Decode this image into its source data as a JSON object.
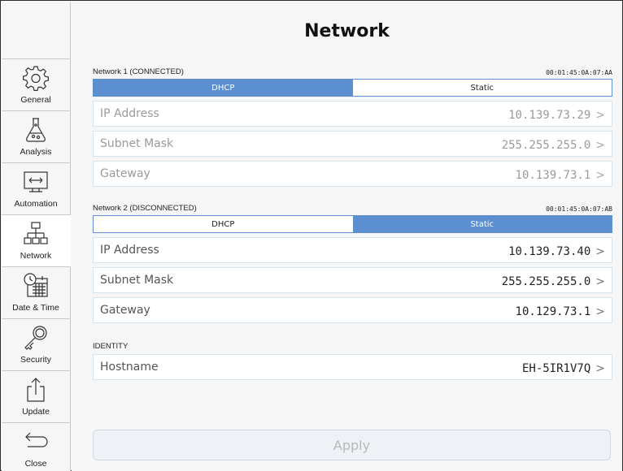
{
  "page_title": "Network",
  "sidebar": {
    "items": [
      {
        "label": "General",
        "icon": "gear-icon",
        "active": false
      },
      {
        "label": "Analysis",
        "icon": "flask-icon",
        "active": false
      },
      {
        "label": "Automation",
        "icon": "automation-icon",
        "active": false
      },
      {
        "label": "Network",
        "icon": "network-icon",
        "active": true
      },
      {
        "label": "Date & Time",
        "icon": "calendar-clock-icon",
        "active": false
      },
      {
        "label": "Security",
        "icon": "key-icon",
        "active": false
      },
      {
        "label": "Update",
        "icon": "upload-icon",
        "active": false
      },
      {
        "label": "Close",
        "icon": "back-arrow-icon",
        "active": false
      }
    ]
  },
  "network1": {
    "name": "Network 1 (CONNECTED)",
    "mac": "00:01:45:0A:07:AA",
    "mode_options": [
      "DHCP",
      "Static"
    ],
    "selected_mode": "DHCP",
    "fields": [
      {
        "label": "IP Address",
        "value": "10.139.73.29",
        "chevron": ">"
      },
      {
        "label": "Subnet Mask",
        "value": "255.255.255.0",
        "chevron": ">"
      },
      {
        "label": "Gateway",
        "value": "10.139.73.1",
        "chevron": ">"
      }
    ]
  },
  "network2": {
    "name": "Network 2 (DISCONNECTED)",
    "mac": "00:01:45:0A:07:AB",
    "mode_options": [
      "DHCP",
      "Static"
    ],
    "selected_mode": "Static",
    "fields": [
      {
        "label": "IP Address",
        "value": "10.139.73.40",
        "chevron": ">"
      },
      {
        "label": "Subnet Mask",
        "value": "255.255.255.0",
        "chevron": ">"
      },
      {
        "label": "Gateway",
        "value": "10.129.73.1",
        "chevron": ">"
      }
    ]
  },
  "identity": {
    "heading": "IDENTITY",
    "hostname_label": "Hostname",
    "hostname_value": "EH-5IR1V7Q",
    "chevron": ">"
  },
  "apply_label": "Apply",
  "colors": {
    "accent": "#5b8fd0",
    "row_border": "#d6e4f0",
    "disabled_text": "#9a9a9a"
  }
}
